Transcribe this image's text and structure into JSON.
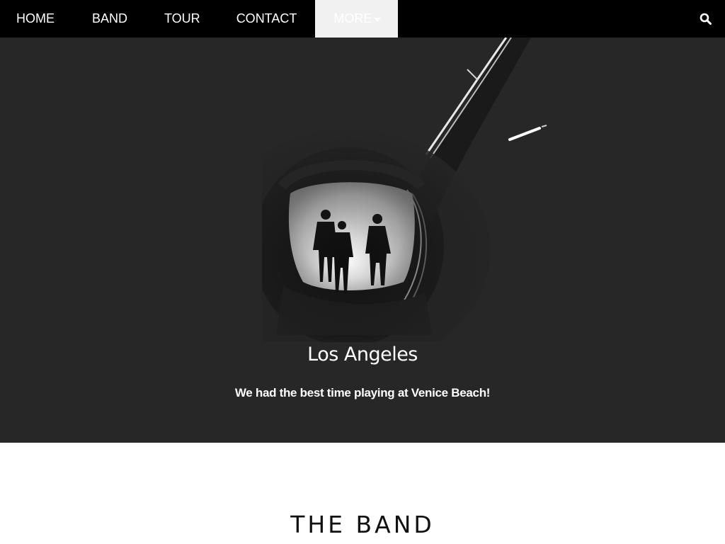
{
  "nav": {
    "items": [
      {
        "label": "HOME"
      },
      {
        "label": "BAND"
      },
      {
        "label": "TOUR"
      },
      {
        "label": "CONTACT"
      }
    ],
    "more_label": "MORE",
    "search_icon": "search-icon"
  },
  "hero": {
    "caption_title": "Los Angeles",
    "caption_text": "We had the best time playing at Venice Beach!"
  },
  "band": {
    "title": "THE BAND"
  },
  "colors": {
    "navbar_bg": "#000000",
    "hero_bg": "#272727",
    "more_bg": "#f1f1f1",
    "text_light": "#ffffff"
  }
}
